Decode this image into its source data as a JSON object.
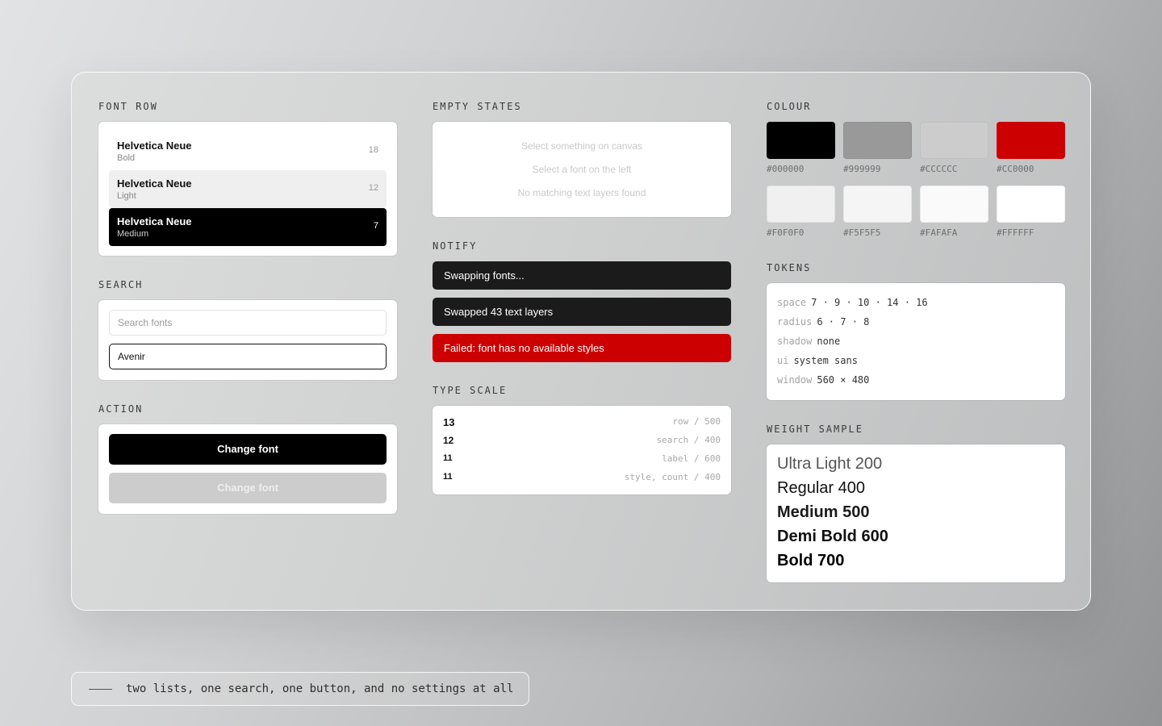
{
  "font_row": {
    "title": "FONT ROW",
    "rows": [
      {
        "name": "Helvetica Neue",
        "style": "Bold",
        "count": "18"
      },
      {
        "name": "Helvetica Neue",
        "style": "Light",
        "count": "12"
      },
      {
        "name": "Helvetica Neue",
        "style": "Medium",
        "count": "7"
      }
    ]
  },
  "search": {
    "title": "SEARCH",
    "placeholder": "Search fonts",
    "value": "Avenir"
  },
  "action": {
    "title": "ACTION",
    "primary_label": "Change font",
    "disabled_label": "Change font"
  },
  "empty_states": {
    "title": "EMPTY STATES",
    "lines": [
      "Select something on canvas",
      "Select a font on the left",
      "No matching text layers found"
    ]
  },
  "notify": {
    "title": "NOTIFY",
    "toasts": [
      {
        "text": "Swapping fonts...",
        "kind": "dark"
      },
      {
        "text": "Swapped 43 text layers",
        "kind": "dark"
      },
      {
        "text": "Failed: font has no available styles",
        "kind": "error"
      }
    ]
  },
  "type_scale": {
    "title": "TYPE SCALE",
    "rows": [
      {
        "size": "13",
        "desc": "row / 500"
      },
      {
        "size": "12",
        "desc": "search / 400"
      },
      {
        "size": "11",
        "desc": "label / 600"
      },
      {
        "size": "11",
        "desc": "style, count / 400"
      }
    ]
  },
  "colour": {
    "title": "COLOUR",
    "swatches": [
      {
        "hex": "#000000"
      },
      {
        "hex": "#999999"
      },
      {
        "hex": "#CCCCCC"
      },
      {
        "hex": "#CC0000"
      },
      {
        "hex": "#F0F0F0"
      },
      {
        "hex": "#F5F5F5"
      },
      {
        "hex": "#FAFAFA"
      },
      {
        "hex": "#FFFFFF"
      }
    ]
  },
  "tokens": {
    "title": "TOKENS",
    "items": [
      {
        "key": "space",
        "value": "7 · 9 · 10 · 14 · 16"
      },
      {
        "key": "radius",
        "value": "6 · 7 · 8"
      },
      {
        "key": "shadow",
        "value": "none"
      },
      {
        "key": "ui",
        "value": "system sans"
      },
      {
        "key": "window",
        "value": "560 × 480"
      }
    ]
  },
  "weight_sample": {
    "title": "WEIGHT SAMPLE",
    "items": [
      {
        "label": "Ultra Light 200",
        "weight": "200"
      },
      {
        "label": "Regular 400",
        "weight": "400"
      },
      {
        "label": "Medium 500",
        "weight": "500"
      },
      {
        "label": "Demi Bold 600",
        "weight": "600"
      },
      {
        "label": "Bold 700",
        "weight": "700"
      }
    ]
  },
  "caption": "two lists, one search, one button, and no settings at all"
}
